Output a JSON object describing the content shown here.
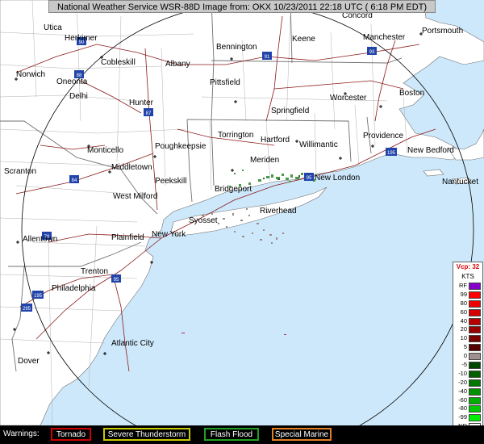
{
  "title": "National Weather Service WSR-88D Image from:  OKX 10/23/2011  22:18 UTC  ( 6:18 PM EDT)",
  "colors": {
    "ocean": "#cde8fa",
    "land": "#ffffff",
    "county": "#b0b0b0",
    "state": "#707070",
    "road": "#8b1a1a",
    "range_ring": "#000000"
  },
  "cities": [
    {
      "name": "Utica"
    },
    {
      "name": "Herkimer"
    },
    {
      "name": "Cobleskill"
    },
    {
      "name": "Albany"
    },
    {
      "name": "Bennington"
    },
    {
      "name": "Keene"
    },
    {
      "name": "Concord"
    },
    {
      "name": "Manchester"
    },
    {
      "name": "Portsmouth"
    },
    {
      "name": "Norwich"
    },
    {
      "name": "Oneonta"
    },
    {
      "name": "Delhi"
    },
    {
      "name": "Pittsfield"
    },
    {
      "name": "Hunter"
    },
    {
      "name": "Springfield"
    },
    {
      "name": "Worcester"
    },
    {
      "name": "Boston"
    },
    {
      "name": "Torrington"
    },
    {
      "name": "Hartford"
    },
    {
      "name": "Willimantic"
    },
    {
      "name": "Providence"
    },
    {
      "name": "New Bedford"
    },
    {
      "name": "Monticello"
    },
    {
      "name": "Poughkeepsie"
    },
    {
      "name": "Middletown"
    },
    {
      "name": "Meriden"
    },
    {
      "name": "Scranton"
    },
    {
      "name": "New London"
    },
    {
      "name": "Nantucket"
    },
    {
      "name": "Peekskill"
    },
    {
      "name": "Bridgeport"
    },
    {
      "name": "West Milford"
    },
    {
      "name": "Riverhead"
    },
    {
      "name": "Syosset"
    },
    {
      "name": "Allentown"
    },
    {
      "name": "Plainfield"
    },
    {
      "name": "New York"
    },
    {
      "name": "Trenton"
    },
    {
      "name": "Philadelphia"
    },
    {
      "name": "Atlantic City"
    },
    {
      "name": "Dover"
    }
  ],
  "shields": [
    {
      "label": "90"
    },
    {
      "label": "88"
    },
    {
      "label": "91"
    },
    {
      "label": "93"
    },
    {
      "label": "87"
    },
    {
      "label": "84"
    },
    {
      "label": "95"
    },
    {
      "label": "95"
    },
    {
      "label": "78"
    },
    {
      "label": "195"
    },
    {
      "label": "195"
    },
    {
      "label": "295"
    }
  ],
  "legend": {
    "title": "Vcp: 32",
    "units": "KTS",
    "items": [
      {
        "label": "RF",
        "color": "#8800cc"
      },
      {
        "label": "99",
        "color": "#ff0000"
      },
      {
        "label": "80",
        "color": "#ee0000"
      },
      {
        "label": "60",
        "color": "#d40000"
      },
      {
        "label": "40",
        "color": "#b80000"
      },
      {
        "label": "20",
        "color": "#9a0000"
      },
      {
        "label": "10",
        "color": "#7a0000"
      },
      {
        "label": "5",
        "color": "#560000"
      },
      {
        "label": "0",
        "color": "#a09090"
      },
      {
        "label": "-5",
        "color": "#004400"
      },
      {
        "label": "-10",
        "color": "#005f00"
      },
      {
        "label": "-20",
        "color": "#007800"
      },
      {
        "label": "-40",
        "color": "#009200"
      },
      {
        "label": "-60",
        "color": "#00ad00"
      },
      {
        "label": "-80",
        "color": "#00c800"
      },
      {
        "label": "-99",
        "color": "#00ee00"
      },
      {
        "label": "ND",
        "color": "#ffffff"
      }
    ]
  },
  "warnings": {
    "label": "Warnings:",
    "items": [
      {
        "name": "Tornado",
        "color": "#cc0000"
      },
      {
        "name": "Severe Thunderstorm",
        "color": "#c8c800"
      },
      {
        "name": "Flash Flood",
        "color": "#20a020"
      },
      {
        "name": "Special Marine",
        "color": "#e08020"
      }
    ]
  }
}
